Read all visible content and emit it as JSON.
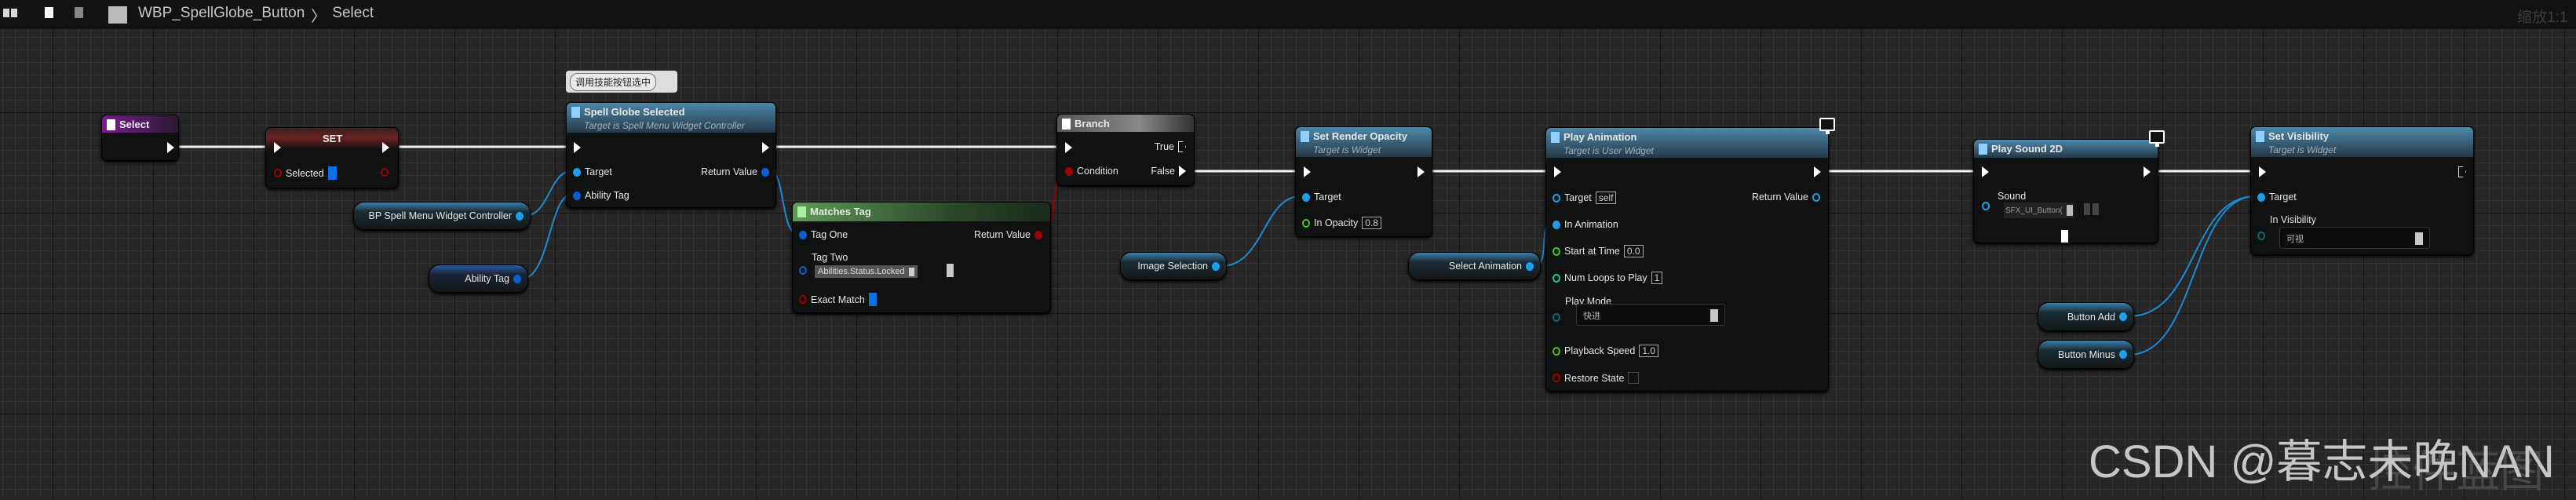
{
  "toolbar": {
    "breadcrumb_root": "WBP_SpellGlobe_Button",
    "breadcrumb_sep": "〉",
    "breadcrumb_current": "Select",
    "zoom": "缩放1:1"
  },
  "colors": {
    "event_header": "#6a1c7a",
    "set_header": "#5a1e1e",
    "function_header": "#35607c",
    "pure_header": "#3f6b3a",
    "branch_header": "#6a6a6a",
    "object_pin": "#1aa0e8",
    "struct_pin": "#0a60d0",
    "bool_pin": "#a00000",
    "float_pin": "#3ec81c",
    "exec_wire": "#ffffff",
    "object_wire": "#1c8ad4"
  },
  "comment": {
    "text": "调用技能按钮选中"
  },
  "nodes": {
    "select_event": {
      "title": "Select"
    },
    "set": {
      "title": "SET",
      "selected": "Selected"
    },
    "spell_globe_selected": {
      "title": "Spell Globe Selected",
      "subtitle": "Target is Spell Menu Widget Controller",
      "target": "Target",
      "ability_tag": "Ability Tag",
      "return_value": "Return Value"
    },
    "bp_spell_menu_getter": {
      "label": "BP Spell Menu Widget Controller"
    },
    "ability_tag_getter": {
      "label": "Ability Tag"
    },
    "matches_tag": {
      "title": "Matches Tag",
      "tag_one": "Tag One",
      "tag_two": "Tag Two",
      "tag_two_value": "Abilities.Status.Locked",
      "exact_match": "Exact Match",
      "return_value": "Return Value"
    },
    "branch": {
      "title": "Branch",
      "condition": "Condition",
      "true": "True",
      "false": "False"
    },
    "set_render_opacity": {
      "title": "Set Render Opacity",
      "subtitle": "Target is Widget",
      "target": "Target",
      "in_opacity": "In Opacity",
      "in_opacity_value": "0.8"
    },
    "image_selection_getter": {
      "label": "Image Selection"
    },
    "select_animation_getter": {
      "label": "Select Animation"
    },
    "play_animation": {
      "title": "Play Animation",
      "subtitle": "Target is User Widget",
      "target": "Target",
      "target_value": "self",
      "return_value": "Return Value",
      "in_animation": "In Animation",
      "start_at_time": "Start at Time",
      "start_at_time_value": "0.0",
      "num_loops": "Num Loops to Play",
      "num_loops_value": "1",
      "play_mode": "Play Mode",
      "play_mode_value": "快进",
      "playback_speed": "Playback Speed",
      "playback_speed_value": "1.0",
      "restore_state": "Restore State"
    },
    "play_sound_2d": {
      "title": "Play Sound 2D",
      "sound": "Sound",
      "sound_value": "SFX_UI_Button("
    },
    "set_visibility": {
      "title": "Set Visibility",
      "subtitle": "Target is Widget",
      "target": "Target",
      "in_visibility": "In Visibility",
      "in_visibility_value": "可视"
    },
    "button_add_getter": {
      "label": "Button Add"
    },
    "button_minus_getter": {
      "label": "Button Minus"
    }
  },
  "watermark": {
    "text": "CSDN @暮志未晚NAN",
    "background_text": "控件蓝图"
  }
}
